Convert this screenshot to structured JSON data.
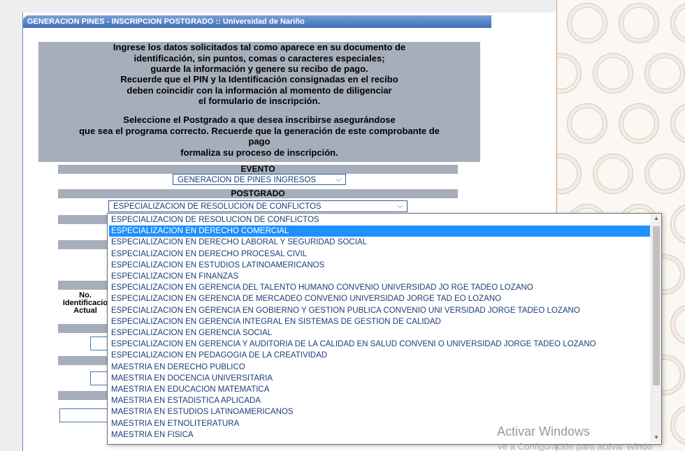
{
  "window": {
    "title": "GENERACION PINES - INSCRIPCION POSTGRADO :: Universidad de Nariño"
  },
  "instructions": {
    "block1": [
      "Ingrese los datos solicitados tal como aparece en su documento de",
      "identificación, sin puntos, comas o caracteres especiales;",
      "guarde la información y genere su recibo de pago."
    ],
    "block2": [
      "Recuerde que el PIN y la Identificación consignadas en el recibo",
      "deben coincidir con la información al momento de diligenciar",
      "el formulario de inscripción."
    ],
    "block3": [
      "Seleccione el Postgrado a que desea inscribirse asegurándose",
      "que sea el programa correcto. Recuerde que la generación de este comprobante de",
      "pago",
      "formaliza su proceso de inscripción."
    ]
  },
  "form": {
    "evento_label": "EVENTO",
    "evento_value": "GENERACION DE PINES INGRESOS",
    "postgrado_label": "POSTGRADO",
    "postgrado_value": "ESPECIALIZACION DE RESOLUCION DE CONFLICTOS",
    "id_label_lines": [
      "No.",
      "Identificacio",
      "Actual"
    ]
  },
  "dropdown": {
    "selected_index": 1,
    "options": [
      "ESPECIALIZACION DE RESOLUCION DE CONFLICTOS",
      "ESPECIALIZACION EN DERECHO COMERCIAL",
      "ESPECIALIZACION EN DERECHO LABORAL Y SEGURIDAD SOCIAL",
      "ESPECIALIZACION EN DERECHO PROCESAL CIVIL",
      "ESPECIALIZACION EN ESTUDIOS LATINOAMERICANOS",
      "ESPECIALIZACION EN FINANZAS",
      "ESPECIALIZACION EN GERENCIA DEL TALENTO HUMANO CONVENIO UNIVERSIDAD JO RGE TADEO LOZANO",
      "ESPECIALIZACION EN GERENCIA DE MERCADEO CONVENIO UNIVERSIDAD JORGE TAD EO LOZANO",
      "ESPECIALIZACION EN GERENCIA EN GOBIERNO Y GESTION PUBLICA CONVENIO UNI VERSIDAD JORGE TADEO LOZANO",
      "ESPECIALIZACION EN GERENCIA INTEGRAL EN SISTEMAS DE GESTION DE CALIDAD",
      "ESPECIALIZACION EN GERENCIA SOCIAL",
      "ESPECIALIZACION EN GERENCIA Y AUDITORIA DE LA CALIDAD EN SALUD CONVENI O UNIVERSIDAD JORGE TADEO LOZANO",
      "ESPECIALIZACION EN PEDAGOGIA DE LA CREATIVIDAD",
      "MAESTRIA EN DERECHO PUBLICO",
      "MAESTRIA EN DOCENCIA UNIVERSITARIA",
      "MAESTRIA EN EDUCACION MATEMATICA",
      "MAESTRIA EN ESTADISTICA APLICADA",
      "MAESTRIA EN ESTUDIOS LATINOAMERICANOS",
      "MAESTRIA EN ETNOLITERATURA",
      "MAESTRIA EN FISICA"
    ]
  },
  "watermark": {
    "line1": "Activar Windows",
    "line2": "Ve a Configuración para activar Windo"
  }
}
